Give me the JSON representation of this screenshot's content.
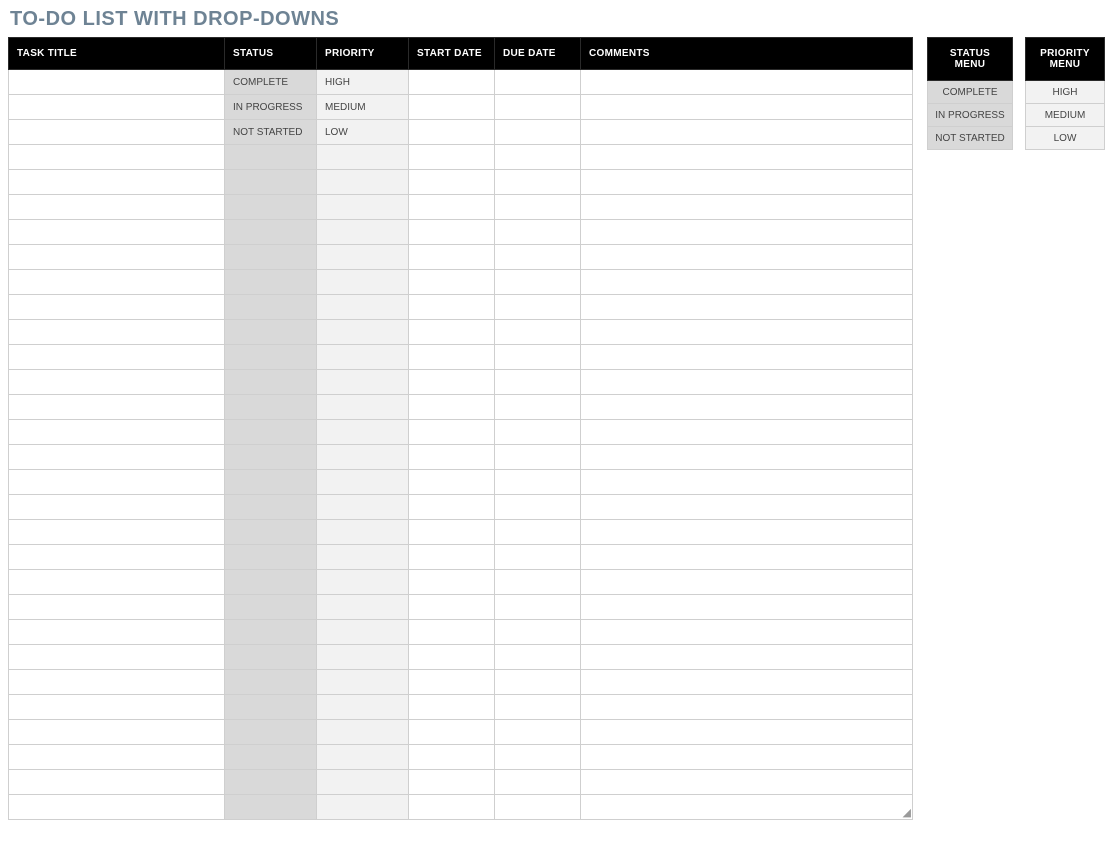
{
  "title": "TO-DO LIST WITH DROP-DOWNS",
  "columns": {
    "task": "TASK TITLE",
    "status": "STATUS",
    "priority": "PRIORITY",
    "start": "START DATE",
    "due": "DUE DATE",
    "comments": "COMMENTS"
  },
  "rows": [
    {
      "task": "",
      "status": "COMPLETE",
      "priority": "HIGH",
      "start": "",
      "due": "",
      "comments": ""
    },
    {
      "task": "",
      "status": "IN PROGRESS",
      "priority": "MEDIUM",
      "start": "",
      "due": "",
      "comments": ""
    },
    {
      "task": "",
      "status": "NOT STARTED",
      "priority": "LOW",
      "start": "",
      "due": "",
      "comments": ""
    },
    {
      "task": "",
      "status": "",
      "priority": "",
      "start": "",
      "due": "",
      "comments": ""
    },
    {
      "task": "",
      "status": "",
      "priority": "",
      "start": "",
      "due": "",
      "comments": ""
    },
    {
      "task": "",
      "status": "",
      "priority": "",
      "start": "",
      "due": "",
      "comments": ""
    },
    {
      "task": "",
      "status": "",
      "priority": "",
      "start": "",
      "due": "",
      "comments": ""
    },
    {
      "task": "",
      "status": "",
      "priority": "",
      "start": "",
      "due": "",
      "comments": ""
    },
    {
      "task": "",
      "status": "",
      "priority": "",
      "start": "",
      "due": "",
      "comments": ""
    },
    {
      "task": "",
      "status": "",
      "priority": "",
      "start": "",
      "due": "",
      "comments": ""
    },
    {
      "task": "",
      "status": "",
      "priority": "",
      "start": "",
      "due": "",
      "comments": ""
    },
    {
      "task": "",
      "status": "",
      "priority": "",
      "start": "",
      "due": "",
      "comments": ""
    },
    {
      "task": "",
      "status": "",
      "priority": "",
      "start": "",
      "due": "",
      "comments": ""
    },
    {
      "task": "",
      "status": "",
      "priority": "",
      "start": "",
      "due": "",
      "comments": ""
    },
    {
      "task": "",
      "status": "",
      "priority": "",
      "start": "",
      "due": "",
      "comments": ""
    },
    {
      "task": "",
      "status": "",
      "priority": "",
      "start": "",
      "due": "",
      "comments": ""
    },
    {
      "task": "",
      "status": "",
      "priority": "",
      "start": "",
      "due": "",
      "comments": ""
    },
    {
      "task": "",
      "status": "",
      "priority": "",
      "start": "",
      "due": "",
      "comments": ""
    },
    {
      "task": "",
      "status": "",
      "priority": "",
      "start": "",
      "due": "",
      "comments": ""
    },
    {
      "task": "",
      "status": "",
      "priority": "",
      "start": "",
      "due": "",
      "comments": ""
    },
    {
      "task": "",
      "status": "",
      "priority": "",
      "start": "",
      "due": "",
      "comments": ""
    },
    {
      "task": "",
      "status": "",
      "priority": "",
      "start": "",
      "due": "",
      "comments": ""
    },
    {
      "task": "",
      "status": "",
      "priority": "",
      "start": "",
      "due": "",
      "comments": ""
    },
    {
      "task": "",
      "status": "",
      "priority": "",
      "start": "",
      "due": "",
      "comments": ""
    },
    {
      "task": "",
      "status": "",
      "priority": "",
      "start": "",
      "due": "",
      "comments": ""
    },
    {
      "task": "",
      "status": "",
      "priority": "",
      "start": "",
      "due": "",
      "comments": ""
    },
    {
      "task": "",
      "status": "",
      "priority": "",
      "start": "",
      "due": "",
      "comments": ""
    },
    {
      "task": "",
      "status": "",
      "priority": "",
      "start": "",
      "due": "",
      "comments": ""
    },
    {
      "task": "",
      "status": "",
      "priority": "",
      "start": "",
      "due": "",
      "comments": ""
    },
    {
      "task": "",
      "status": "",
      "priority": "",
      "start": "",
      "due": "",
      "comments": ""
    }
  ],
  "status_menu": {
    "header": "STATUS MENU",
    "items": [
      "COMPLETE",
      "IN PROGRESS",
      "NOT STARTED"
    ]
  },
  "priority_menu": {
    "header": "PRIORITY MENU",
    "items": [
      "HIGH",
      "MEDIUM",
      "LOW"
    ]
  }
}
